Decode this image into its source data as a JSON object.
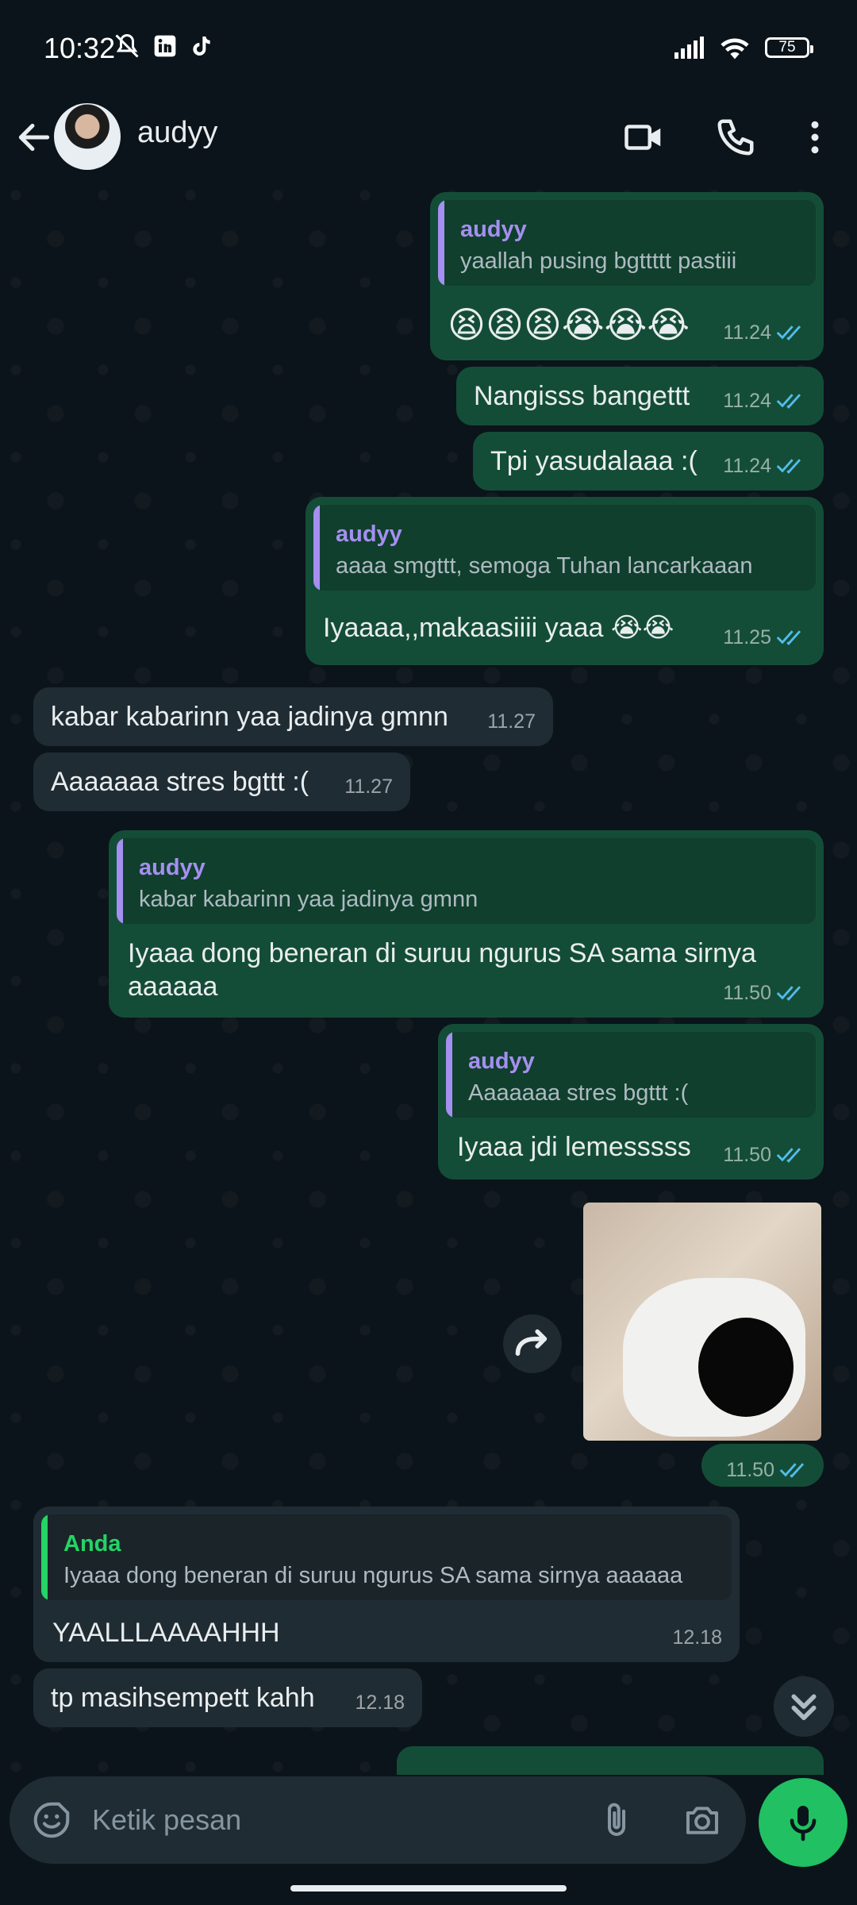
{
  "status_bar": {
    "time": "10:32",
    "battery": "75"
  },
  "header": {
    "contact_name": "audyy",
    "back_icon": "arrow-left-icon",
    "video_icon": "video-call-icon",
    "call_icon": "phone-icon",
    "menu_icon": "more-vert-icon"
  },
  "messages": [
    {
      "dir": "out",
      "quote_name": "audyy",
      "quote_text": "yaallah pusing bgttttt pastiii",
      "text": "😫😫😫😭😭😭",
      "time": "11.24"
    },
    {
      "dir": "out",
      "text": "Nangisss bangettt",
      "time": "11.24"
    },
    {
      "dir": "out",
      "text": "Tpi yasudalaaa :(",
      "time": "11.24"
    },
    {
      "dir": "out",
      "quote_name": "audyy",
      "quote_text": "aaaa smgttt, semoga Tuhan lancarkaaan",
      "text": "Iyaaaa,,makaasiiii yaaa 😭😭",
      "time": "11.25"
    },
    {
      "dir": "in",
      "text": "kabar kabarinn yaa jadinya gmnn",
      "time": "11.27"
    },
    {
      "dir": "in",
      "text": "Aaaaaaa stres bgttt :(",
      "time": "11.27"
    },
    {
      "dir": "out",
      "quote_name": "audyy",
      "quote_text": "kabar kabarinn yaa jadinya gmnn",
      "text_line1": "Iyaaa dong beneran di suruu ngurus SA sama sirnya",
      "text_line2": "aaaaaa",
      "time": "11.50"
    },
    {
      "dir": "out",
      "quote_name": "audyy",
      "quote_text": "Aaaaaaa stres bgttt :(",
      "text": "Iyaaa jdi lemesssss",
      "time": "11.50"
    },
    {
      "dir": "out",
      "type": "image",
      "time": "11.50"
    },
    {
      "dir": "in",
      "quote_name": "Anda",
      "quote_text": "Iyaaa dong beneran di suruu ngurus SA sama sirnya aaaaaa",
      "text": "YAALLLAAAAHHH",
      "time": "12.18"
    },
    {
      "dir": "in",
      "text": "tp masihsempett kahh",
      "time": "12.18"
    }
  ],
  "input": {
    "placeholder": "Ketik pesan",
    "emoji_icon": "sticker-smile-icon",
    "attach_icon": "paperclip-icon",
    "camera_icon": "camera-icon",
    "mic_icon": "mic-icon"
  },
  "colors": {
    "bg": "#0b141a",
    "outgoing": "#144d37",
    "incoming": "#202c33",
    "accent": "#21c063",
    "tick": "#53bdeb",
    "quote_bar_contact": "#a58ff0",
    "quote_bar_self": "#25d366"
  }
}
